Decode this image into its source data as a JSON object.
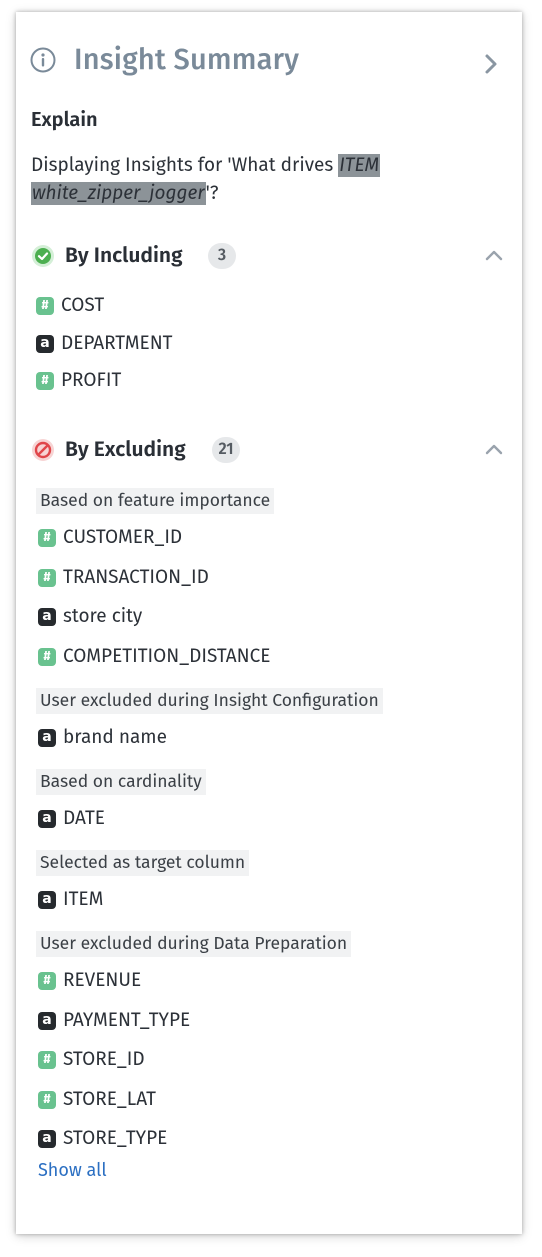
{
  "header": {
    "title": "Insight Summary"
  },
  "explain": {
    "heading": "Explain",
    "text_pre": "Displaying Insights for 'What drives ",
    "highlight_1": "ITEM",
    "highlight_2": "white_zipper_jogger",
    "text_post": "'?"
  },
  "including": {
    "label": "By Including",
    "count": "3",
    "items": [
      {
        "type": "#",
        "label": "COST"
      },
      {
        "type": "a",
        "label": "DEPARTMENT"
      },
      {
        "type": "#",
        "label": "PROFIT"
      }
    ]
  },
  "excluding": {
    "label": "By Excluding",
    "count": "21",
    "groups": [
      {
        "label": "Based on feature importance",
        "items": [
          {
            "type": "#",
            "label": "CUSTOMER_ID"
          },
          {
            "type": "#",
            "label": "TRANSACTION_ID"
          },
          {
            "type": "a",
            "label": "store city"
          },
          {
            "type": "#",
            "label": "COMPETITION_DISTANCE"
          }
        ]
      },
      {
        "label": "User excluded during Insight Configuration",
        "items": [
          {
            "type": "a",
            "label": "brand name"
          }
        ]
      },
      {
        "label": "Based on cardinality",
        "items": [
          {
            "type": "a",
            "label": "DATE"
          }
        ]
      },
      {
        "label": "Selected as target column",
        "items": [
          {
            "type": "a",
            "label": "ITEM"
          }
        ]
      },
      {
        "label": "User excluded during Data Preparation",
        "items": [
          {
            "type": "#",
            "label": "REVENUE"
          },
          {
            "type": "a",
            "label": "PAYMENT_TYPE"
          },
          {
            "type": "#",
            "label": "STORE_ID"
          },
          {
            "type": "#",
            "label": "STORE_LAT"
          },
          {
            "type": "a",
            "label": "STORE_TYPE"
          }
        ]
      }
    ],
    "show_all": "Show all"
  },
  "colors": {
    "title": "#7a8a99",
    "numeric_badge": "#69c28f",
    "text_badge": "#262a2e",
    "include_icon": "#4caf50",
    "exclude_icon": "#e0464a",
    "link": "#2b6fc2"
  },
  "icons": {
    "header": "info-icon",
    "collapse": "chevron-right-icon",
    "including": "check-circle-icon",
    "excluding": "prohibited-icon",
    "section_toggle": "chevron-up-icon"
  }
}
